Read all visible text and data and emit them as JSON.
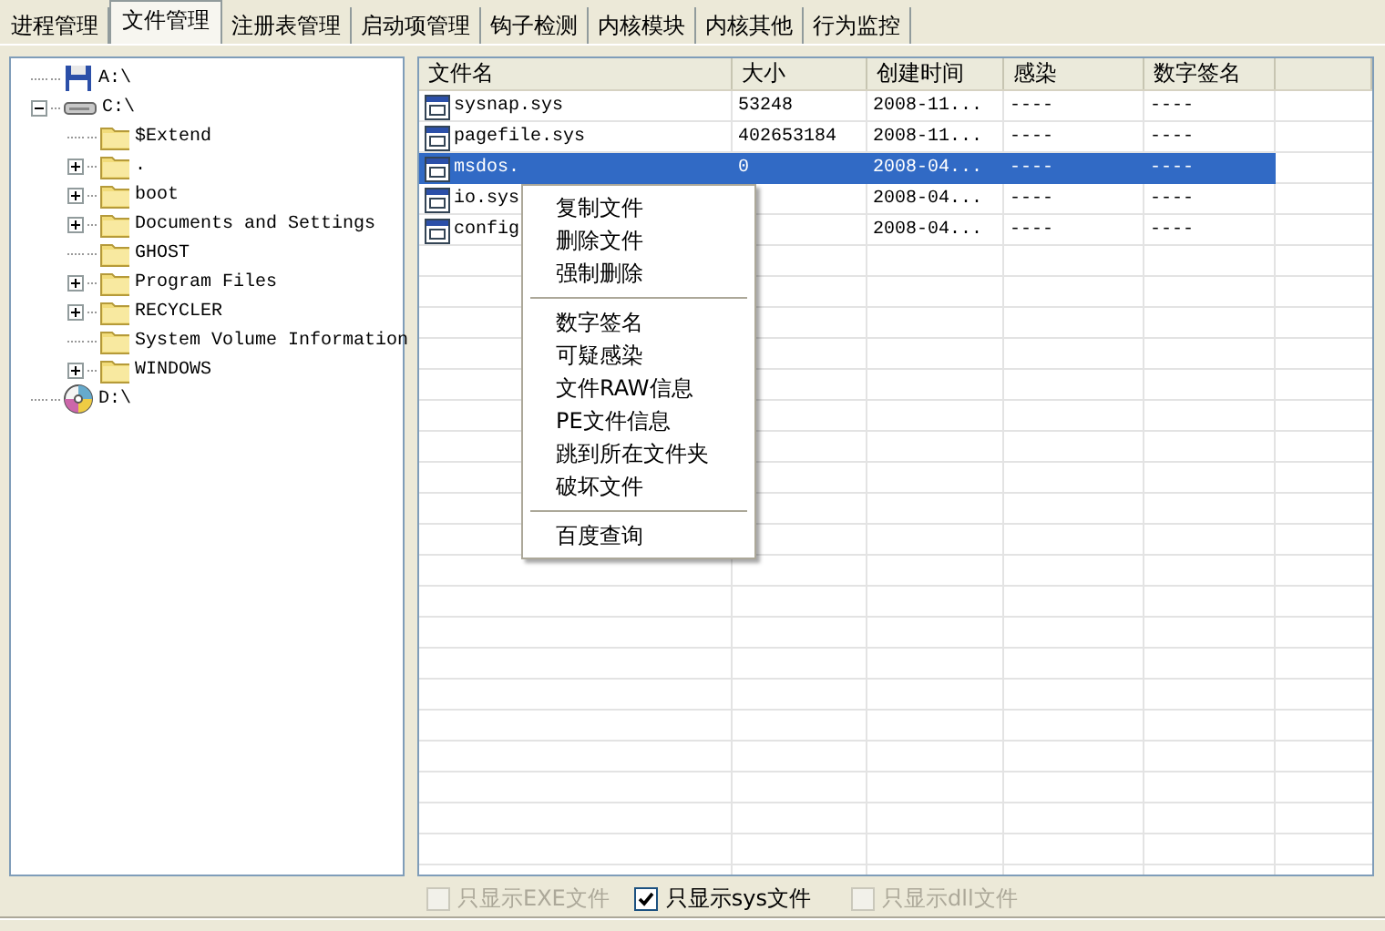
{
  "tabs": [
    {
      "label": "进程管理",
      "selected": false
    },
    {
      "label": "文件管理",
      "selected": true
    },
    {
      "label": "注册表管理",
      "selected": false
    },
    {
      "label": "启动项管理",
      "selected": false
    },
    {
      "label": "钩子检测",
      "selected": false
    },
    {
      "label": "内核模块",
      "selected": false
    },
    {
      "label": "内核其他",
      "selected": false
    },
    {
      "label": "行为监控",
      "selected": false
    }
  ],
  "tree": [
    {
      "label": "A:\\",
      "kind": "floppy"
    },
    {
      "label": "C:\\",
      "kind": "disk",
      "expanded": true,
      "children": [
        {
          "label": "$Extend",
          "kind": "folder"
        },
        {
          "label": ".",
          "kind": "folder",
          "expanded": false
        },
        {
          "label": "boot",
          "kind": "folder",
          "expanded": false
        },
        {
          "label": "Documents and Settings",
          "kind": "folder",
          "expanded": false
        },
        {
          "label": "GHOST",
          "kind": "folder"
        },
        {
          "label": "Program Files",
          "kind": "folder",
          "expanded": false
        },
        {
          "label": "RECYCLER",
          "kind": "folder",
          "expanded": false
        },
        {
          "label": "System Volume Information",
          "kind": "folder"
        },
        {
          "label": "WINDOWS",
          "kind": "folder",
          "expanded": false
        }
      ]
    },
    {
      "label": "D:\\",
      "kind": "cd"
    }
  ],
  "table": {
    "columns": [
      "文件名",
      "大小",
      "创建时间",
      "感染",
      "数字签名"
    ],
    "rows": [
      {
        "cells": [
          "sysnap.sys",
          "53248",
          "2008-11...",
          "----",
          "----"
        ],
        "selected": false
      },
      {
        "cells": [
          "pagefile.sys",
          "402653184",
          "2008-11...",
          "----",
          "----"
        ],
        "selected": false
      },
      {
        "cells": [
          "msdos.",
          "0",
          "2008-04...",
          "----",
          "----"
        ],
        "selected": true
      },
      {
        "cells": [
          "io.sys",
          "",
          "2008-04...",
          "----",
          "----"
        ],
        "selected": false
      },
      {
        "cells": [
          "config",
          "",
          "2008-04...",
          "----",
          "----"
        ],
        "selected": false
      }
    ]
  },
  "context_menu": {
    "groups": [
      [
        "复制文件",
        "删除文件",
        "强制删除"
      ],
      [
        "数字签名",
        "可疑感染",
        "文件RAW信息",
        "PE文件信息",
        "跳到所在文件夹",
        "破坏文件"
      ],
      [
        "百度查询"
      ]
    ]
  },
  "filters": [
    {
      "label": "只显示EXE文件",
      "checked": false,
      "disabled": true
    },
    {
      "label": "只显示sys文件",
      "checked": true,
      "disabled": false
    },
    {
      "label": "只显示dll文件",
      "checked": false,
      "disabled": true
    }
  ]
}
